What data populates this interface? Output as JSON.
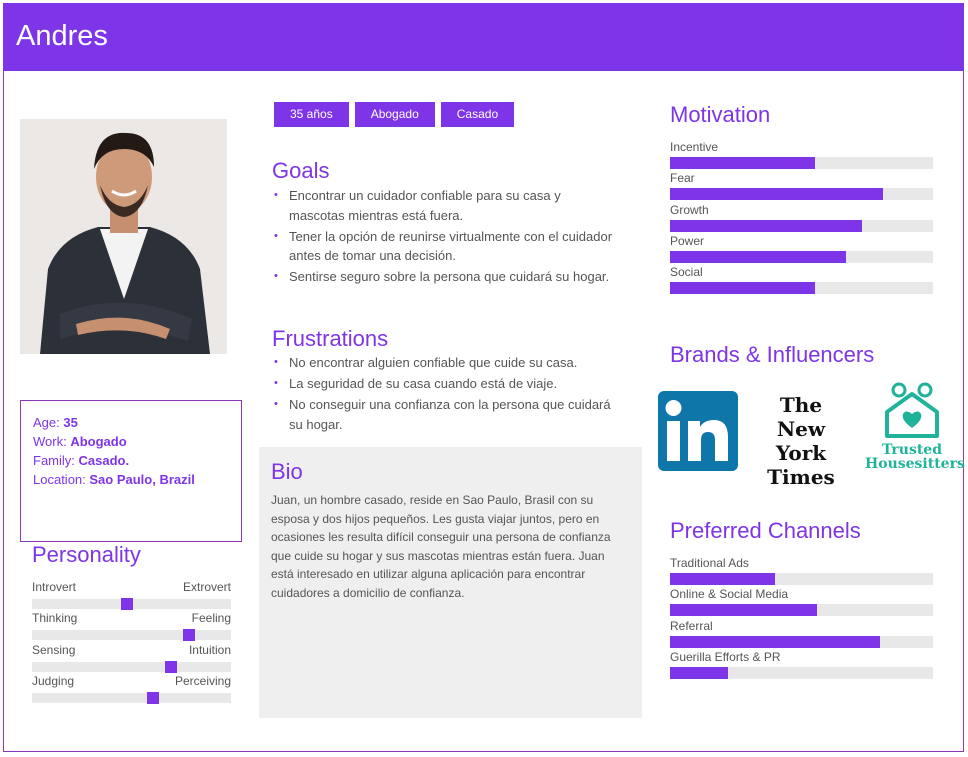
{
  "persona": {
    "name": "Andres"
  },
  "info": {
    "age_label": "Age:",
    "age": "35",
    "work_label": "Work:",
    "work": "Abogado",
    "family_label": "Family:",
    "family": "Casado.",
    "location_label": "Location:",
    "location": "Sao Paulo, Brazil"
  },
  "personality": {
    "title": "Personality",
    "traits": [
      {
        "left": "Introvert",
        "right": "Extrovert",
        "value": 0.475
      },
      {
        "left": "Thinking",
        "right": "Feeling",
        "value": 0.79
      },
      {
        "left": "Sensing",
        "right": "Intuition",
        "value": 0.7
      },
      {
        "left": "Judging",
        "right": "Perceiving",
        "value": 0.61
      }
    ]
  },
  "tags": [
    "35 años",
    "Abogado",
    "Casado"
  ],
  "goals": {
    "title": "Goals",
    "items": [
      "Encontrar un cuidador confiable para su casa y mascotas mientras está fuera.",
      "Tener la opción de reunirse virtualmente con el cuidador antes de tomar una decisión.",
      "Sentirse seguro sobre la persona que cuidará su hogar."
    ]
  },
  "frustrations": {
    "title": "Frustrations",
    "items": [
      "No encontrar alguien confiable que cuide su casa.",
      "La seguridad de su casa cuando está de viaje.",
      "No conseguir una confianza con la persona que cuidará su hogar."
    ]
  },
  "bio": {
    "title": "Bio",
    "text": "Juan, un hombre casado, reside en Sao Paulo, Brasil con su esposa y dos hijos pequeños. Les gusta viajar juntos, pero en ocasiones les resulta difícil conseguir una persona de confianza que cuide su hogar y sus mascotas mientras están fuera. Juan está interesado en utilizar alguna aplicación para encontrar cuidadores a domicilio de confianza."
  },
  "motivation": {
    "title": "Motivation",
    "bars": [
      {
        "label": "Incentive",
        "value": 0.55
      },
      {
        "label": "Fear",
        "value": 0.81
      },
      {
        "label": "Growth",
        "value": 0.73
      },
      {
        "label": "Power",
        "value": 0.67
      },
      {
        "label": "Social",
        "value": 0.55
      }
    ]
  },
  "brands": {
    "title": "Brands & Influencers",
    "linkedin_text": "in",
    "nyt_text": [
      "The",
      "New York",
      "Times"
    ],
    "th_text": [
      "Trusted",
      "Housesitters"
    ]
  },
  "channels": {
    "title": "Preferred Channels",
    "bars": [
      {
        "label": "Traditional Ads",
        "value": 0.4
      },
      {
        "label": "Online & Social Media",
        "value": 0.56
      },
      {
        "label": "Referral",
        "value": 0.8
      },
      {
        "label": "Guerilla Efforts & PR",
        "value": 0.22
      }
    ]
  },
  "colors": {
    "accent": "#7e35e8",
    "track": "#e8e8e8",
    "linkedin": "#0e76a8",
    "trusted": "#1fb39a"
  }
}
